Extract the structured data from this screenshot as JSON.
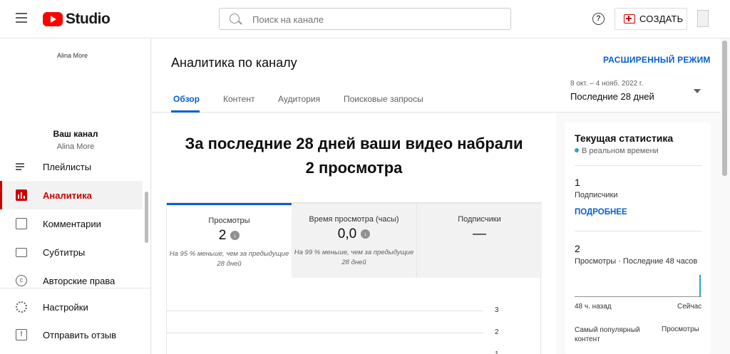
{
  "header": {
    "logo_text": "Studio",
    "search_placeholder": "Поиск на канале",
    "help_label": "?",
    "create_label": "СОЗДАТЬ"
  },
  "sidebar": {
    "channel_image_alt": "Alina More",
    "channel_label": "Ваш канал",
    "channel_name": "Alina More",
    "items": [
      {
        "label": "Плейлисты",
        "icon": "playlist-icon"
      },
      {
        "label": "Аналитика",
        "icon": "analytics-icon",
        "active": true
      },
      {
        "label": "Комментарии",
        "icon": "comments-icon"
      },
      {
        "label": "Субтитры",
        "icon": "subtitles-icon"
      },
      {
        "label": "Авторские права",
        "icon": "copyright-icon"
      },
      {
        "label": "Настройки",
        "icon": "gear-icon"
      },
      {
        "label": "Отправить отзыв",
        "icon": "feedback-icon"
      }
    ]
  },
  "main": {
    "title": "Аналитика по каналу",
    "advanced_mode": "РАСШИРЕННЫЙ РЕЖИМ",
    "tabs": [
      "Обзор",
      "Контент",
      "Аудитория",
      "Поисковые запросы"
    ],
    "date_range": "8 окт. – 4 нояб. 2022 г.",
    "date_period": "Последние 28 дней",
    "headline_line1": "За последние 28 дней ваши видео набрали",
    "headline_line2": "2 просмотра",
    "metrics": [
      {
        "label": "Просмотры",
        "value": "2",
        "note_line1": "На 95 % меньше, чем за предыдущие",
        "note_line2": "28 дней"
      },
      {
        "label": "Время просмотра (часы)",
        "value": "0,0",
        "note_line1": "На 99 % меньше, чем за предыдущие",
        "note_line2": "28 дней"
      },
      {
        "label": "Подписчики",
        "value": "—"
      }
    ],
    "chart_axis": [
      "3",
      "2",
      "1"
    ]
  },
  "realtime": {
    "title": "Текущая статистика",
    "subtitle": "В реальном времени",
    "subscribers_value": "1",
    "subscribers_label": "Подписчики",
    "more_link": "ПОДРОБНЕЕ",
    "views_value": "2",
    "views_label": "Просмотры · Последние 48 часов",
    "spark_left": "48 ч. назад",
    "spark_right": "Сейчас",
    "popular_label": "Самый популярный контент",
    "popular_right": "Просмотры",
    "accent_color": "#2ba6c2"
  }
}
